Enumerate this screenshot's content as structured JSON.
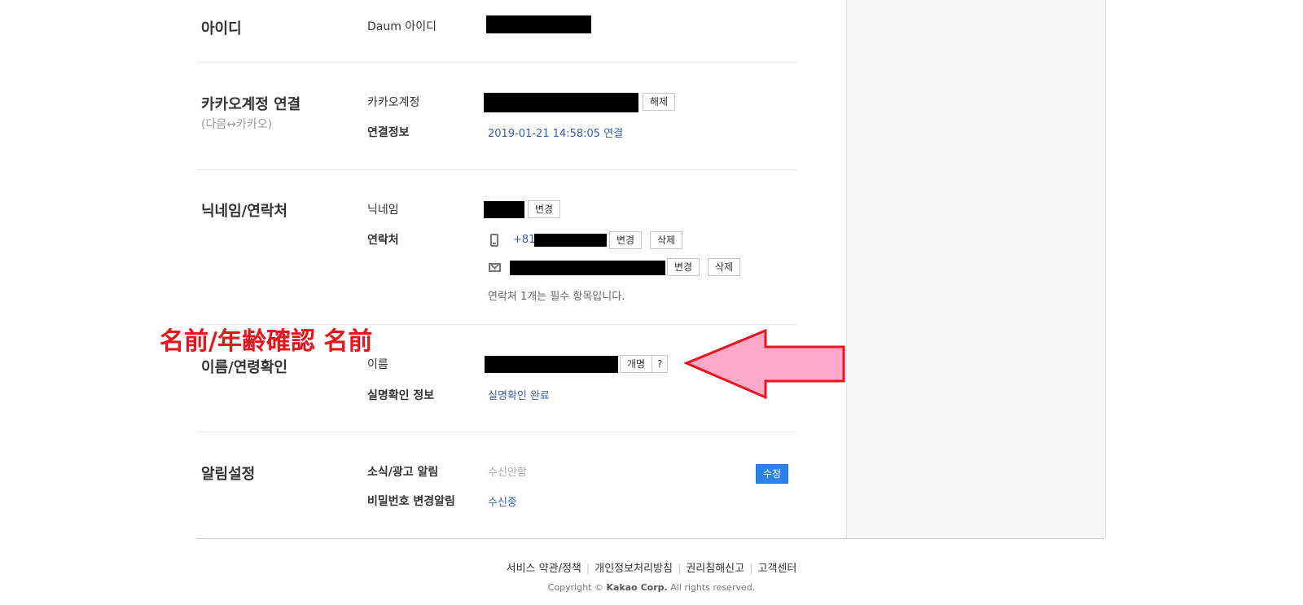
{
  "sections": {
    "id": {
      "title": "아이디",
      "label": "Daum 아이디"
    },
    "kakao": {
      "title": "카카오계정 연결",
      "subtitle": "(다음↔카카오)",
      "account_label": "카카오계정",
      "release_button": "해제",
      "link_info_label": "연결정보",
      "link_info_value": "2019-01-21 14:58:05 연결"
    },
    "nickname": {
      "title": "닉네임/연락처",
      "nickname_label": "닉네임",
      "change_button": "변경",
      "contact_label": "연락처",
      "phone_prefix": "+81",
      "phone_change_button": "변경",
      "phone_delete_button": "삭제",
      "email_change_button": "변경",
      "email_delete_button": "삭제",
      "note": "연락처 1개는 필수 항목입니다."
    },
    "name": {
      "title": "이름/연령확인",
      "name_label": "이름",
      "rename_button": "개명",
      "help_button": "?",
      "verify_label": "실명확인 정보",
      "verify_value": "실명확인 완료"
    },
    "notify": {
      "title": "알림설정",
      "ad_label": "소식/광고 알림",
      "ad_value": "수신안함",
      "password_label": "비밀번호 변경알림",
      "password_value": "수신중",
      "edit_button": "수정"
    }
  },
  "annotation": {
    "text": "名前/年齢確認 名前",
    "color": "#e8141b",
    "arrow_fill": "#ffa8c8",
    "arrow_direction": "left"
  },
  "footer": {
    "links": [
      "서비스 약관/정책",
      "개인정보처리방침",
      "권리침해신고",
      "고객센터"
    ],
    "copyright_prefix": "Copyright ©",
    "copyright_company": "Kakao Corp.",
    "copyright_suffix": "All rights reserved."
  },
  "colors": {
    "link": "#3a5fae",
    "primary_button": "#2d83e6"
  },
  "icons": [
    "phone-icon",
    "mail-icon"
  ]
}
